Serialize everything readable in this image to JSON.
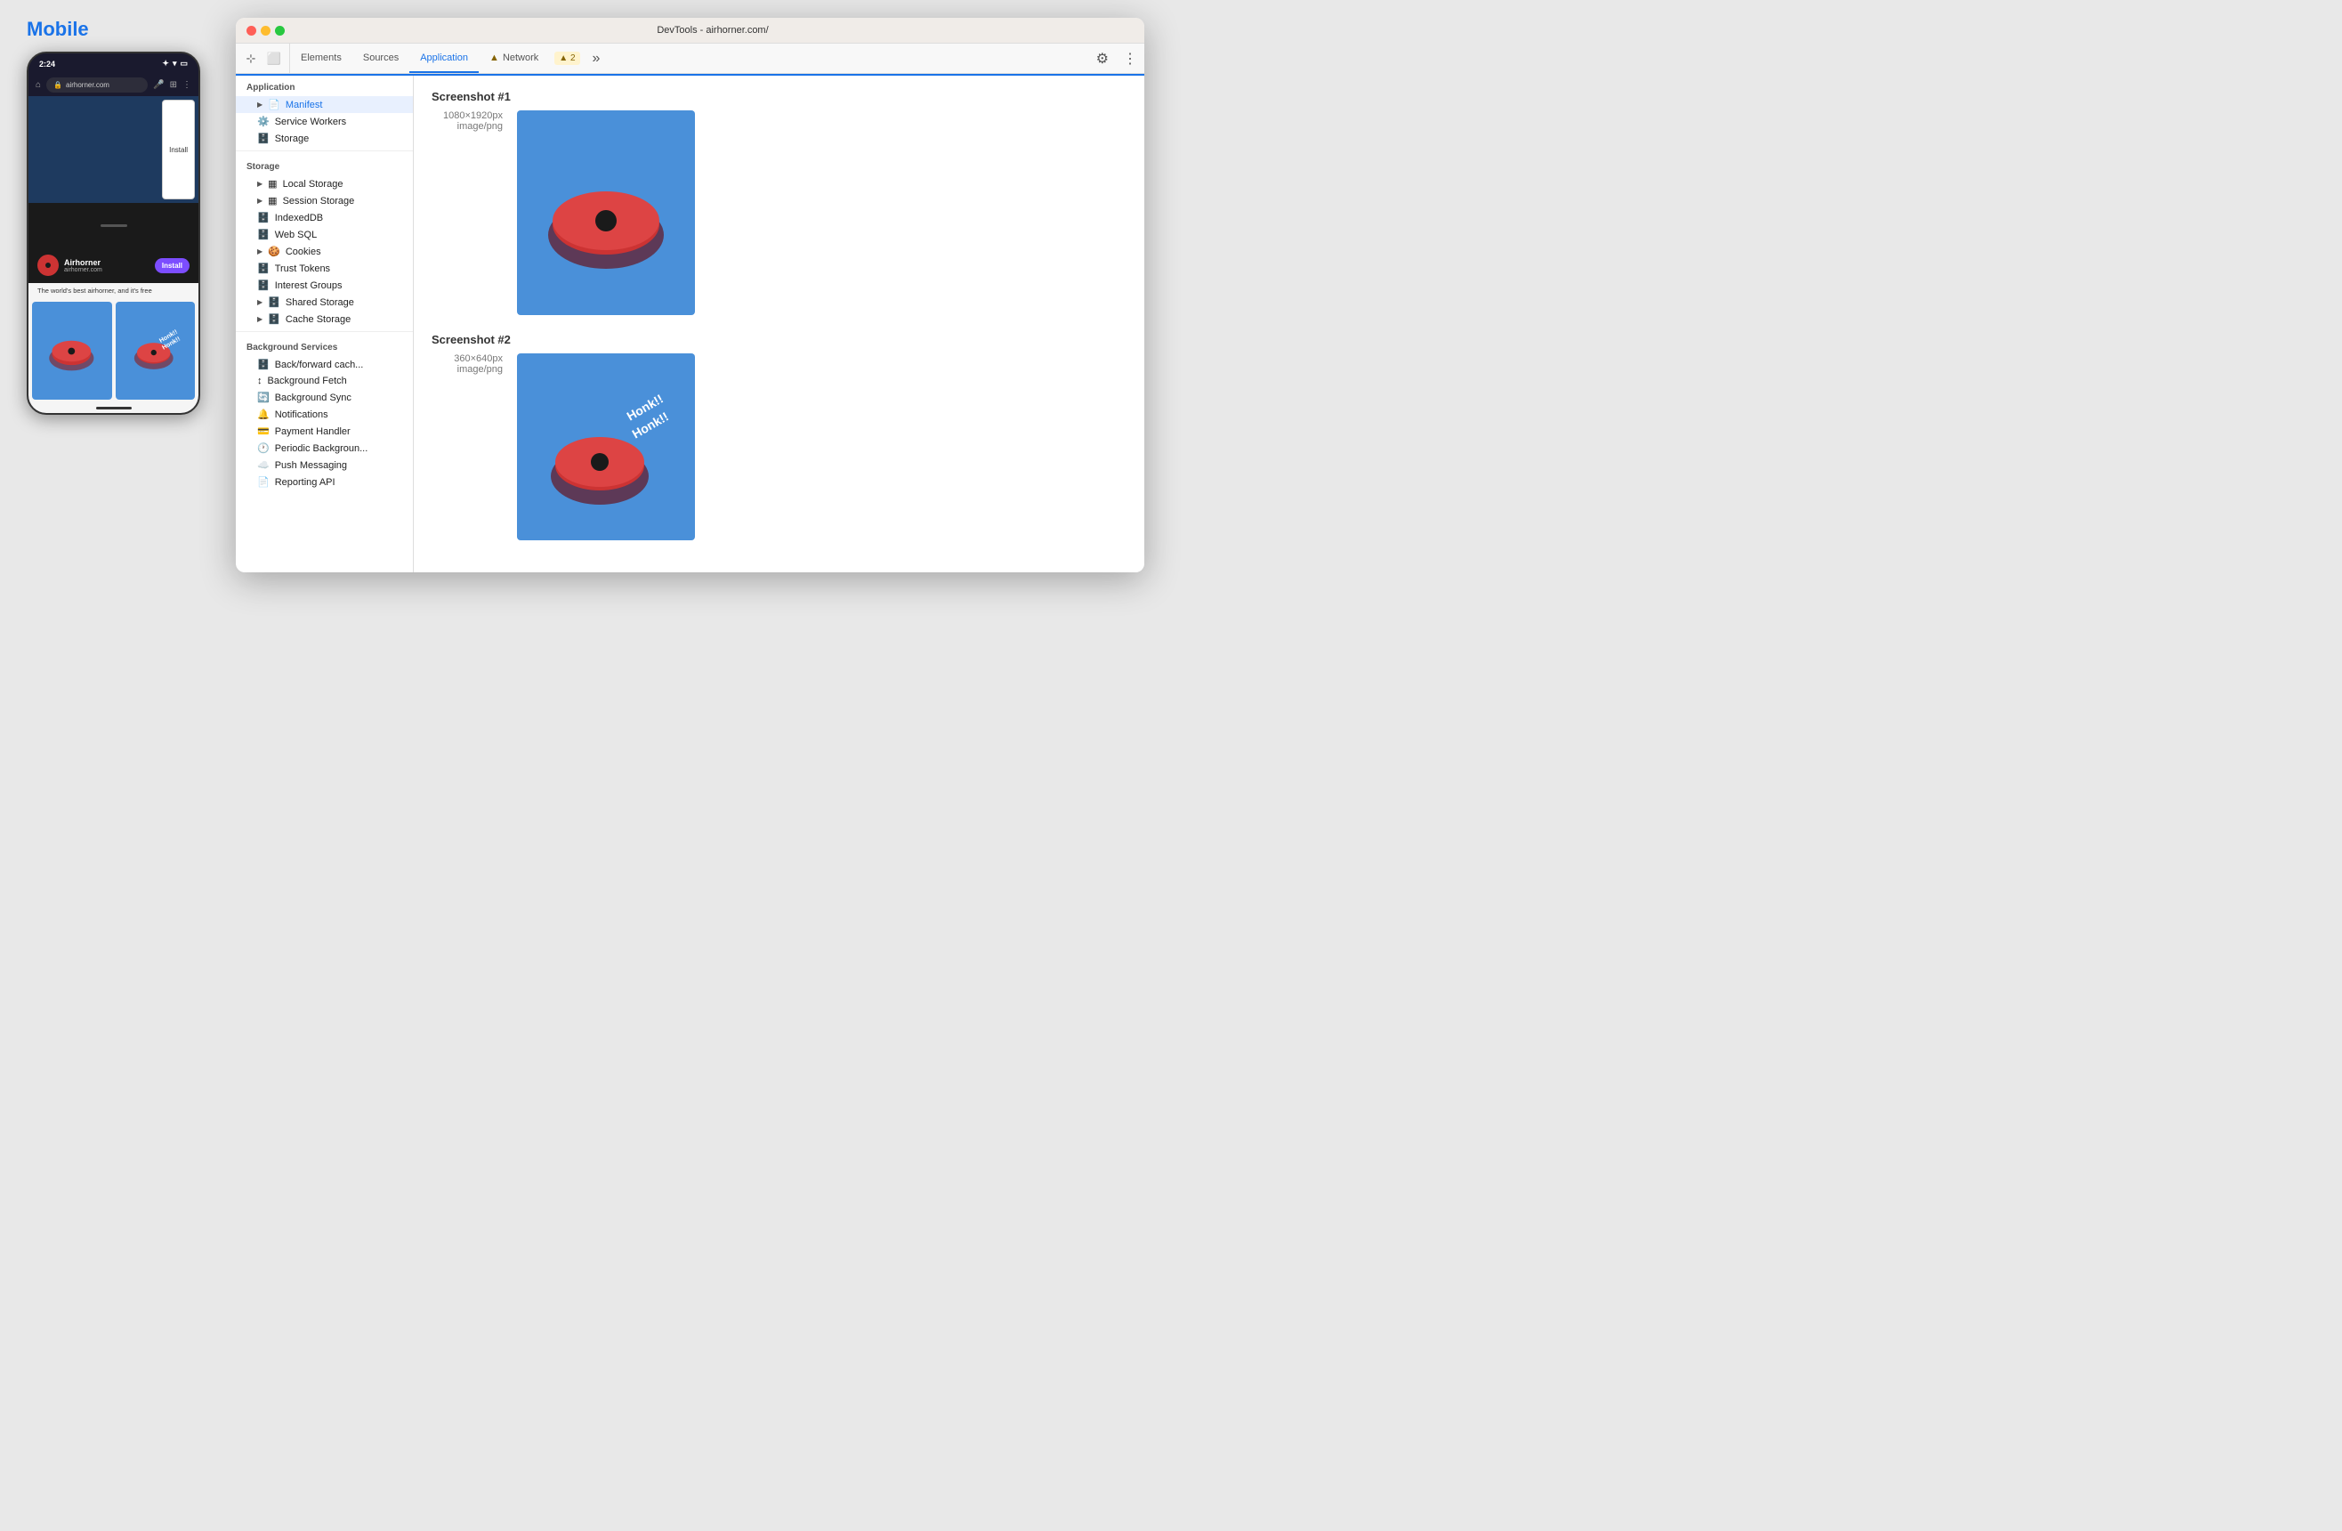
{
  "mobile": {
    "title": "Mobile",
    "status_time": "2:24",
    "address": "airhorner.com",
    "install_btn": "Install",
    "app_name": "Airhorner",
    "app_url": "airhorner.com",
    "install_banner_btn": "Install",
    "description": "The world's best airhorner, and it's free"
  },
  "devtools": {
    "title": "DevTools - airhorner.com/",
    "tabs": [
      {
        "label": "Elements",
        "active": false
      },
      {
        "label": "Sources",
        "active": false
      },
      {
        "label": "Application",
        "active": true
      },
      {
        "label": "Network",
        "active": false,
        "warn": "▲ 2"
      }
    ],
    "sidebar": {
      "application_section": "Application",
      "items_application": [
        {
          "label": "Manifest",
          "icon": "📄",
          "expandable": true
        },
        {
          "label": "Service Workers",
          "icon": "⚙️"
        },
        {
          "label": "Storage",
          "icon": "🗄️"
        }
      ],
      "storage_section": "Storage",
      "items_storage": [
        {
          "label": "Local Storage",
          "icon": "▦",
          "expandable": true
        },
        {
          "label": "Session Storage",
          "icon": "▦",
          "expandable": true
        },
        {
          "label": "IndexedDB",
          "icon": "🗄️"
        },
        {
          "label": "Web SQL",
          "icon": "🗄️"
        },
        {
          "label": "Cookies",
          "icon": "🍪",
          "expandable": true
        },
        {
          "label": "Trust Tokens",
          "icon": "🗄️"
        },
        {
          "label": "Interest Groups",
          "icon": "🗄️"
        },
        {
          "label": "Shared Storage",
          "icon": "🗄️",
          "expandable": true
        },
        {
          "label": "Cache Storage",
          "icon": "🗄️",
          "expandable": true
        }
      ],
      "background_section": "Background Services",
      "items_background": [
        {
          "label": "Back/forward cache",
          "icon": "🗄️"
        },
        {
          "label": "Background Fetch",
          "icon": "↕"
        },
        {
          "label": "Background Sync",
          "icon": "🔄"
        },
        {
          "label": "Notifications",
          "icon": "🔔"
        },
        {
          "label": "Payment Handler",
          "icon": "💳"
        },
        {
          "label": "Periodic Background...",
          "icon": "🕐"
        },
        {
          "label": "Push Messaging",
          "icon": "☁️"
        },
        {
          "label": "Reporting API",
          "icon": "📄"
        }
      ]
    },
    "content": {
      "screenshot1": {
        "label": "Screenshot #1",
        "dimensions": "1080×1920px",
        "type": "image/png"
      },
      "screenshot2": {
        "label": "Screenshot #2",
        "dimensions": "360×640px",
        "type": "image/png"
      }
    }
  }
}
